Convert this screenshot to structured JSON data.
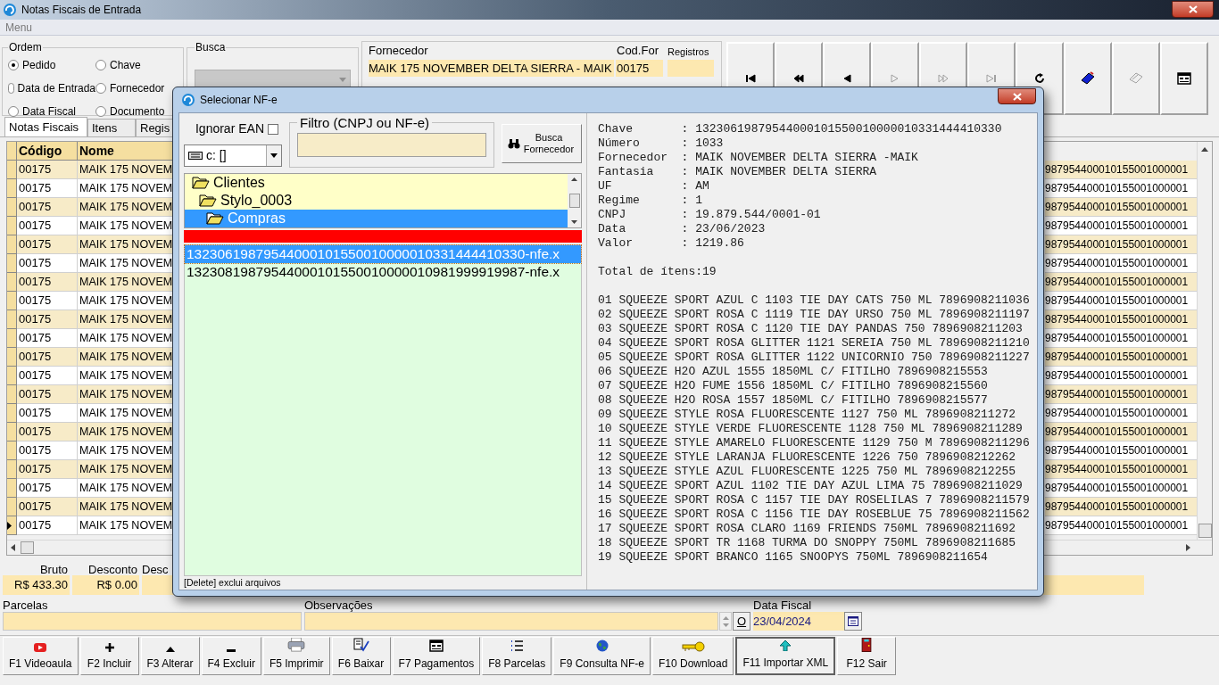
{
  "window": {
    "title": "Notas Fiscais de Entrada"
  },
  "menu": [
    "Menu"
  ],
  "ordem": {
    "title": "Ordem",
    "options": [
      {
        "label": "Pedido",
        "selected": true
      },
      {
        "label": "Chave",
        "selected": false
      },
      {
        "label": "Data de Entrada",
        "selected": false
      },
      {
        "label": "Fornecedor",
        "selected": false
      },
      {
        "label": "Data Fiscal",
        "selected": false
      },
      {
        "label": "Documento",
        "selected": false
      }
    ]
  },
  "busca": {
    "title": "Busca",
    "disabled": true
  },
  "fornecedor": {
    "label": "Fornecedor",
    "value": "MAIK 175 NOVEMBER DELTA SIERRA - MAIK",
    "cod_label": "Cod.For",
    "cod_value": "00175",
    "registros_label": "Registros"
  },
  "toolbar": [
    {
      "disabled": false
    },
    {
      "disabled": false
    },
    {
      "disabled": false
    },
    {
      "disabled": true
    },
    {
      "disabled": true
    },
    {
      "disabled": true
    },
    {
      "disabled": false
    },
    {
      "disabled": false
    },
    {
      "disabled": true
    },
    {
      "disabled": false
    }
  ],
  "tabs": [
    {
      "label": "Notas Fiscais",
      "selected": true
    },
    {
      "label": "Itens",
      "selected": false
    },
    {
      "label": "Regis",
      "selected": false
    }
  ],
  "grid": {
    "columns": [
      "Código",
      "Nome"
    ],
    "rows": [
      {
        "codigo": "00175",
        "nome": "MAIK 175 NOVEM",
        "column_3": "987954400010155001000001",
        "current": false
      },
      {
        "codigo": "00175",
        "nome": "MAIK 175 NOVEM",
        "column_3": "987954400010155001000001",
        "current": false
      },
      {
        "codigo": "00175",
        "nome": "MAIK 175 NOVEM",
        "column_3": "987954400010155001000001",
        "current": false
      },
      {
        "codigo": "00175",
        "nome": "MAIK 175 NOVEM",
        "column_3": "987954400010155001000001",
        "current": false
      },
      {
        "codigo": "00175",
        "nome": "MAIK 175 NOVEM",
        "column_3": "987954400010155001000001",
        "current": false
      },
      {
        "codigo": "00175",
        "nome": "MAIK 175 NOVEM",
        "column_3": "987954400010155001000001",
        "current": false
      },
      {
        "codigo": "00175",
        "nome": "MAIK 175 NOVEM",
        "column_3": "987954400010155001000001",
        "current": false
      },
      {
        "codigo": "00175",
        "nome": "MAIK 175 NOVEM",
        "column_3": "987954400010155001000001",
        "current": false
      },
      {
        "codigo": "00175",
        "nome": "MAIK 175 NOVEM",
        "column_3": "987954400010155001000001",
        "current": false
      },
      {
        "codigo": "00175",
        "nome": "MAIK 175 NOVEM",
        "column_3": "987954400010155001000001",
        "current": false
      },
      {
        "codigo": "00175",
        "nome": "MAIK 175 NOVEM",
        "column_3": "987954400010155001000001",
        "current": false
      },
      {
        "codigo": "00175",
        "nome": "MAIK 175 NOVEM",
        "column_3": "987954400010155001000001",
        "current": false
      },
      {
        "codigo": "00175",
        "nome": "MAIK 175 NOVEM",
        "column_3": "987954400010155001000001",
        "current": false
      },
      {
        "codigo": "00175",
        "nome": "MAIK 175 NOVEM",
        "column_3": "987954400010155001000001",
        "current": false
      },
      {
        "codigo": "00175",
        "nome": "MAIK 175 NOVEM",
        "column_3": "987954400010155001000001",
        "current": false
      },
      {
        "codigo": "00175",
        "nome": "MAIK 175 NOVEM",
        "column_3": "987954400010155001000001",
        "current": false
      },
      {
        "codigo": "00175",
        "nome": "MAIK 175 NOVEM",
        "column_3": "987954400010155001000001",
        "current": false
      },
      {
        "codigo": "00175",
        "nome": "MAIK 175 NOVEM",
        "column_3": "987954400010155001000001",
        "current": false
      },
      {
        "codigo": "00175",
        "nome": "MAIK 175 NOVEM",
        "column_3": "987954400010155001000001",
        "current": false
      },
      {
        "codigo": "00175",
        "nome": "MAIK 175 NOVEM",
        "column_3": "987954400010155001000001",
        "current": true
      }
    ]
  },
  "totals": [
    {
      "label": "Bruto",
      "value": "R$ 433.30"
    },
    {
      "label": "Desconto",
      "value": "R$ 0.00"
    },
    {
      "label": "Desc"
    }
  ],
  "parcelas": {
    "label": "Parcelas"
  },
  "observacoes": {
    "label": "Observações",
    "button": "O"
  },
  "data_fiscal": {
    "label": "Data Fiscal",
    "value": "23/04/2024"
  },
  "fkeys": [
    {
      "label": "F1 Videoaula",
      "focused": false
    },
    {
      "label": "F2 Incluir",
      "focused": false
    },
    {
      "label": "F3 Alterar",
      "focused": false
    },
    {
      "label": "F4 Excluir",
      "focused": false
    },
    {
      "label": "F5 Imprimir",
      "focused": false
    },
    {
      "label": "F6 Baixar",
      "focused": false
    },
    {
      "label": "F7 Pagamentos",
      "focused": false
    },
    {
      "label": "F8 Parcelas",
      "focused": false
    },
    {
      "label": "F9 Consulta NF-e",
      "focused": false
    },
    {
      "label": "F10 Download",
      "focused": false
    },
    {
      "label": "F11 Importar XML",
      "focused": true
    },
    {
      "label": "F12 Sair",
      "focused": false
    }
  ],
  "dialog": {
    "title": "Selecionar NF-e",
    "ignorar_ean": {
      "label": "Ignorar EAN",
      "checked": false
    },
    "drive": "c: []",
    "filtro": {
      "label": "Filtro (CNPJ ou NF-e)"
    },
    "busca_button": "Busca Fornecedor",
    "tree": [
      {
        "label": "Clientes",
        "selected": false,
        "children": [
          {
            "label": "Stylo_0003",
            "selected": false,
            "children": [
              {
                "label": "Compras",
                "selected": true
              }
            ]
          }
        ]
      }
    ],
    "files": [
      {
        "name": "13230619879544000101550010000010331444410330-nfe.x",
        "selected": true
      },
      {
        "name": "13230819879544000101550010000010981999919987-nfe.x",
        "selected": false
      }
    ],
    "status": "[Delete] exclui arquivos",
    "details": [
      "Chave       : 13230619879544000101550010000010331444410330",
      "Número      : 1033",
      "Fornecedor  : MAIK NOVEMBER DELTA SIERRA -MAIK",
      "Fantasia    : MAIK NOVEMBER DELTA SIERRA",
      "UF          : AM",
      "Regime      : 1",
      "CNPJ        : 19.879.544/0001-01",
      "Data        : 23/06/2023",
      "Valor       : 1219.86"
    ],
    "total_itens": "Total de ítens:19",
    "items": [
      "01 SQUEEZE SPORT AZUL C 1103 TIE DAY CATS 750 ML 7896908211036",
      "02 SQUEEZE SPORT ROSA C 1119 TIE DAY URSO 750 ML 7896908211197",
      "03 SQUEEZE SPORT ROSA C 1120 TIE DAY PANDAS 750 7896908211203",
      "04 SQUEEZE SPORT ROSA GLITTER 1121 SEREIA 750 ML 7896908211210",
      "05 SQUEEZE SPORT ROSA GLITTER 1122 UNICORNIO 750 7896908211227",
      "06 SQUEEZE H2O AZUL 1555 1850ML C/ FITILHO 7896908215553",
      "07 SQUEEZE H2O FUME 1556 1850ML C/ FITILHO 7896908215560",
      "08 SQUEEZE H2O ROSA 1557 1850ML C/ FITILHO 7896908215577",
      "09 SQUEEZE STYLE ROSA FLUORESCENTE 1127 750 ML 7896908211272",
      "10 SQUEEZE STYLE VERDE FLUORESCENTE 1128 750 ML 7896908211289",
      "11 SQUEEZE STYLE AMARELO FLUORESCENTE 1129 750 M 7896908211296",
      "12 SQUEEZE STYLE LARANJA FLUORESCENTE 1226 750 7896908212262",
      "13 SQUEEZE STYLE AZUL FLUORESCENTE 1225 750 ML 7896908212255",
      "14 SQUEEZE SPORT AZUL 1102 TIE DAY AZUL LIMA 75 7896908211029",
      "15 SQUEEZE SPORT ROSA C 1157 TIE DAY ROSELILAS 7 7896908211579",
      "16 SQUEEZE SPORT ROSA C 1156 TIE DAY ROSEBLUE 75 7896908211562",
      "17 SQUEEZE SPORT ROSA CLARO 1169 FRIENDS 750ML 7896908211692",
      "18 SQUEEZE SPORT TR 1168 TURMA DO SNOPPY 750ML 7896908211685",
      "19 SQUEEZE SPORT BRANCO 1165 SNOOPYS 750ML 7896908211654"
    ]
  }
}
